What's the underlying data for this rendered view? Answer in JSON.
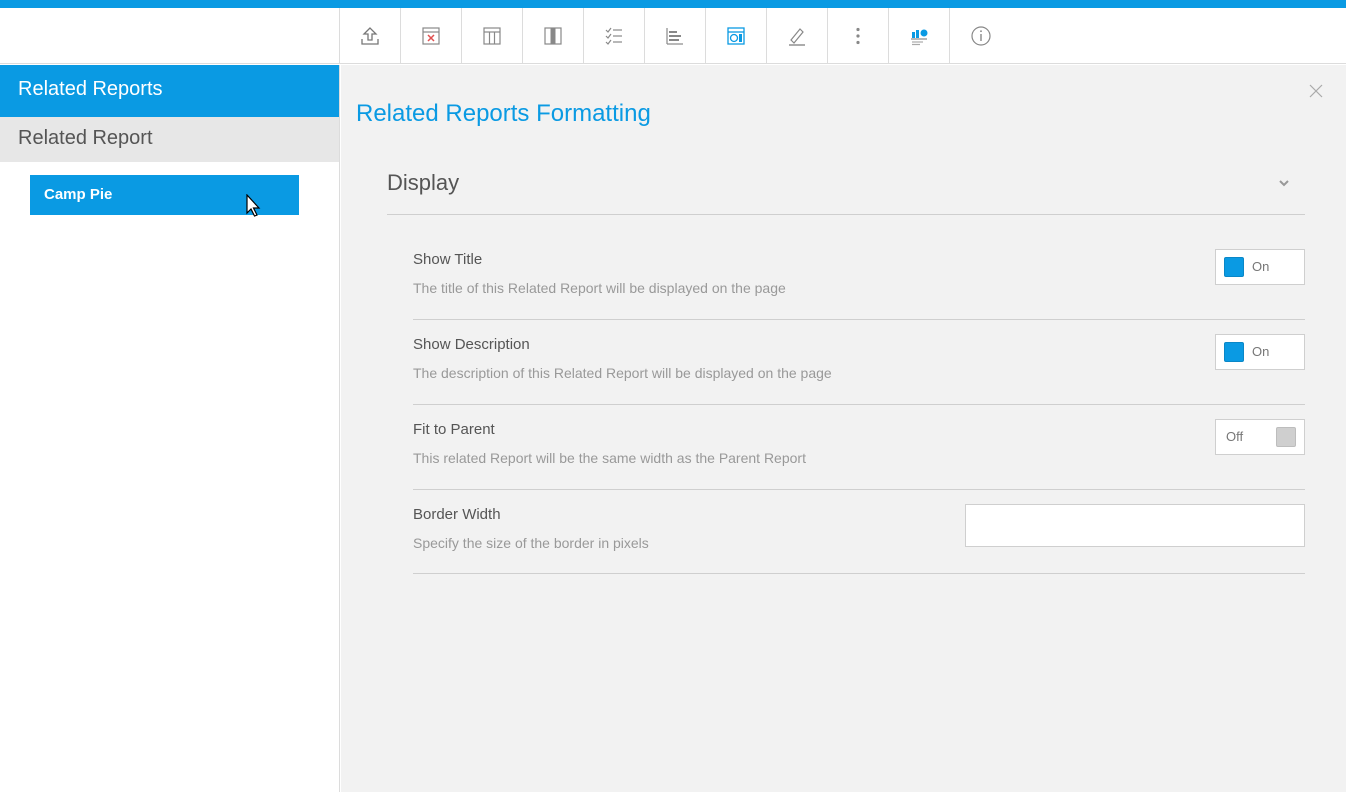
{
  "colors": {
    "accent": "#0a9ae3",
    "panel_bg": "#f2f2f2",
    "divider": "#cfcfcf"
  },
  "toolbar": {
    "buttons": [
      {
        "icon": "export-upload-icon"
      },
      {
        "icon": "report-delete-icon"
      },
      {
        "icon": "table-columns-icon"
      },
      {
        "icon": "column-format-icon"
      },
      {
        "icon": "checklist-icon"
      },
      {
        "icon": "bar-chart-icon"
      },
      {
        "icon": "related-report-icon",
        "active": true
      },
      {
        "icon": "pencil-edit-icon"
      },
      {
        "icon": "more-vertical-icon"
      },
      {
        "icon": "chart-series-icon",
        "active": true
      },
      {
        "icon": "info-icon"
      }
    ]
  },
  "sidebar": {
    "header": "Related Reports",
    "subheader": "Related Report",
    "items": [
      {
        "label": "Camp Pie",
        "selected": true
      }
    ]
  },
  "panel": {
    "title": "Related Reports Formatting",
    "section": {
      "title": "Display",
      "expanded": true
    },
    "settings": [
      {
        "label": "Show Title",
        "desc": "The title of this Related Report will be displayed on the page",
        "state": "On"
      },
      {
        "label": "Show Description",
        "desc": "The description of this Related Report will be displayed on the page",
        "state": "On"
      },
      {
        "label": "Fit to Parent",
        "desc": "This related Report will be the same width as the Parent Report",
        "state": "Off"
      },
      {
        "label": "Border Width",
        "desc": "Specify the size of the border in pixels",
        "value": ""
      }
    ]
  }
}
